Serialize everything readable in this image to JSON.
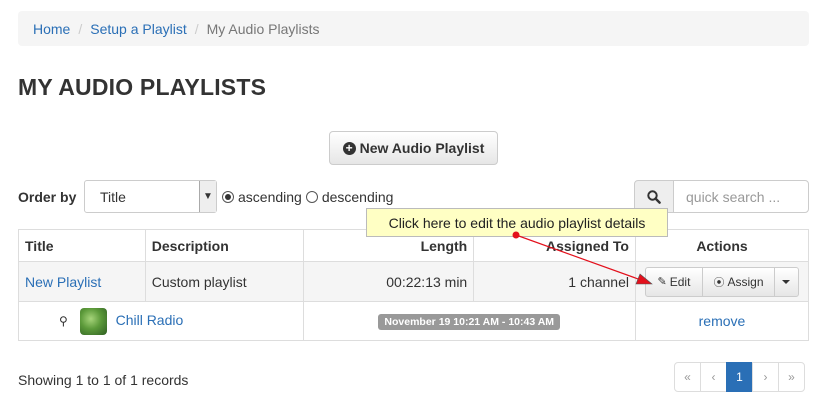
{
  "breadcrumb": {
    "home": "Home",
    "separator": "/",
    "setup": "Setup a Playlist",
    "current": "My Audio Playlists"
  },
  "page_title": "MY AUDIO PLAYLISTS",
  "new_button_label": "New Audio Playlist",
  "order": {
    "label": "Order by",
    "selected": "Title",
    "ascending": "ascending",
    "descending": "descending",
    "direction": "ascending"
  },
  "search": {
    "placeholder": "quick search ..."
  },
  "table": {
    "headers": {
      "title": "Title",
      "description": "Description",
      "length": "Length",
      "assigned_to": "Assigned To",
      "actions": "Actions"
    },
    "rows": [
      {
        "title": "New Playlist",
        "description": "Custom playlist",
        "length": "00:22:13 min",
        "assigned_to": "1 channel",
        "edit_label": "Edit",
        "assign_label": "Assign"
      }
    ],
    "sub_rows": [
      {
        "channel": "Chill Radio",
        "time": "November 19 10:21 AM - 10:43 AM",
        "remove_label": "remove"
      }
    ]
  },
  "tooltip": "Click here to edit the audio playlist details",
  "footer": {
    "showing": "Showing 1 to 1 of 1 records"
  },
  "pagination": {
    "first": "«",
    "prev": "‹",
    "current": "1",
    "next": "›",
    "last": "»"
  },
  "colors": {
    "link": "#2a6fb6",
    "tooltip_bg": "#ffffc4",
    "annotation": "#e3101c",
    "active_page": "#2a6fb6"
  }
}
